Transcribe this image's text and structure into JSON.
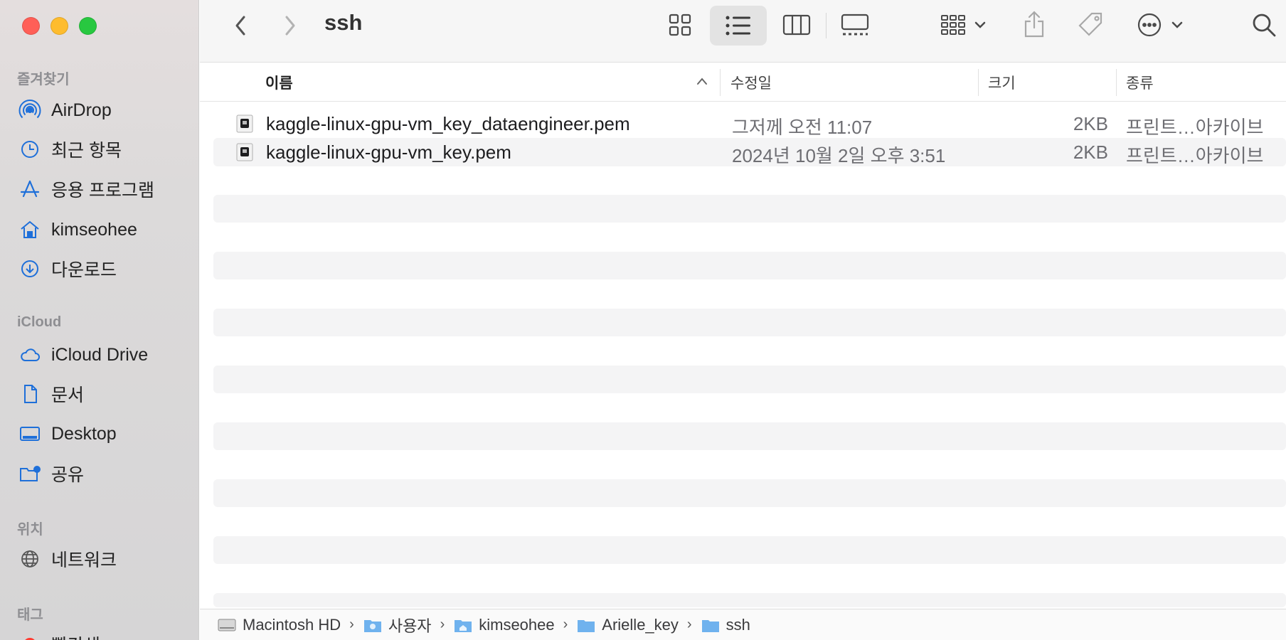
{
  "window": {
    "title": "ssh"
  },
  "sidebar": {
    "favorites_title": "즐겨찾기",
    "favorites": [
      {
        "label": "AirDrop",
        "icon": "airdrop-icon"
      },
      {
        "label": "최근 항목",
        "icon": "clock-icon"
      },
      {
        "label": "응용 프로그램",
        "icon": "applications-icon"
      },
      {
        "label": "kimseohee",
        "icon": "home-icon"
      },
      {
        "label": "다운로드",
        "icon": "download-icon"
      }
    ],
    "icloud_title": "iCloud",
    "icloud": [
      {
        "label": "iCloud Drive",
        "icon": "cloud-icon"
      },
      {
        "label": "문서",
        "icon": "document-icon"
      },
      {
        "label": "Desktop",
        "icon": "desktop-icon"
      },
      {
        "label": "공유",
        "icon": "shared-folder-icon"
      }
    ],
    "locations_title": "위치",
    "locations": [
      {
        "label": "네트워크",
        "icon": "globe-icon"
      }
    ],
    "tags_title": "태그",
    "tags": [
      {
        "label": "빨간색",
        "color": "#ff3b30"
      }
    ]
  },
  "columns": {
    "name": "이름",
    "modified": "수정일",
    "size": "크기",
    "kind": "종류"
  },
  "files": [
    {
      "name": "kaggle-linux-gpu-vm_key_dataengineer.pem",
      "modified": "그저께 오전 11:07",
      "size": "2KB",
      "kind": "프린트…아카이브"
    },
    {
      "name": "kaggle-linux-gpu-vm_key.pem",
      "modified": "2024년 10월 2일 오후 3:51",
      "size": "2KB",
      "kind": "프린트…아카이브"
    }
  ],
  "path": [
    {
      "label": "Macintosh HD",
      "icon": "hard-drive-icon"
    },
    {
      "label": "사용자",
      "icon": "users-folder-icon"
    },
    {
      "label": "kimseohee",
      "icon": "home-folder-icon"
    },
    {
      "label": "Arielle_key",
      "icon": "folder-icon"
    },
    {
      "label": "ssh",
      "icon": "folder-icon"
    }
  ],
  "colors": {
    "accent": "#1e6fd9",
    "close": "#ff5f57",
    "minimize": "#febc2e",
    "zoom": "#28c840"
  }
}
